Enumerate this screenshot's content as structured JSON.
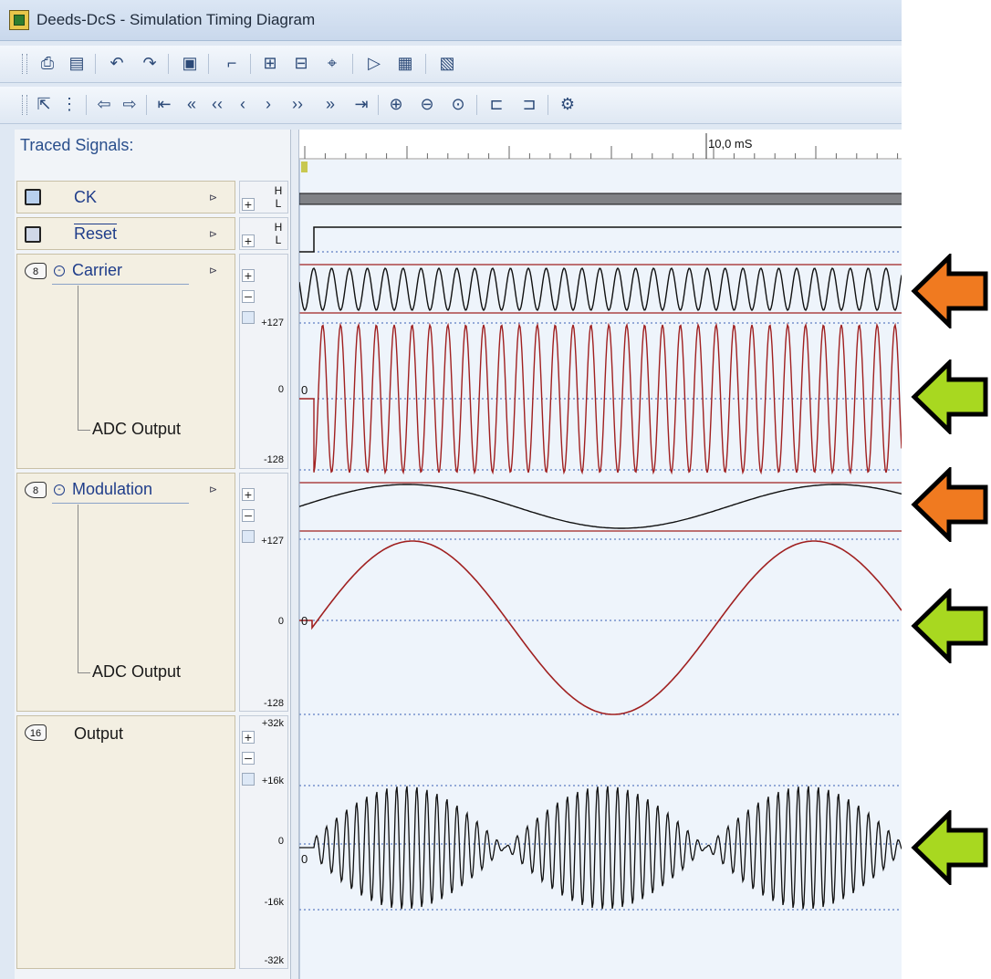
{
  "window": {
    "title": "Deeds-DcS  -  Simulation Timing Diagram"
  },
  "toolbar1": {
    "icons": [
      "print-icon",
      "page-setup-icon",
      "undo-icon",
      "redo-icon",
      "clipboard-icon",
      "edge-icon",
      "grid-icon",
      "signals-icon",
      "cursor-icon",
      "play-icon",
      "stop-icon",
      "view-icon"
    ]
  },
  "toolbar2": {
    "icons": [
      "select-icon",
      "step-icon",
      "left-icon",
      "right-icon",
      "begin-icon",
      "fast-back-icon",
      "back-icon",
      "prev-icon",
      "next-icon",
      "forward-icon",
      "fast-forward-icon",
      "end-icon",
      "zoom-in-icon",
      "zoom-out-icon",
      "zoom-fit-icon",
      "marker-left-icon",
      "marker-right-icon",
      "settings-icon"
    ]
  },
  "left_panel": {
    "heading": "Traced Signals:"
  },
  "timeline": {
    "label": "10,0 mS"
  },
  "signals": [
    {
      "name": "CK",
      "high": "H",
      "low": "L"
    },
    {
      "name": "Reset",
      "high": "H",
      "low": "L"
    },
    {
      "name": "Carrier",
      "sub": "ADC Output",
      "max": "+127",
      "zero": "0",
      "min": "-128",
      "bits": "8"
    },
    {
      "name": "Modulation",
      "sub": "ADC Output",
      "max": "+127",
      "zero": "0",
      "min": "-128",
      "bits": "8"
    },
    {
      "name": "Output",
      "max": "+32k",
      "half": "+16k",
      "zero": "0",
      "nhalf": "-16k",
      "min": "-32k",
      "bits": "16"
    }
  ],
  "wave_labels": {
    "carrier_zero": "0",
    "modulation_zero": "0",
    "output_zero": "0"
  },
  "colors": {
    "analog_wave": "#a02020",
    "digital_wave": "#111111",
    "orange_arrow": "#f07a20",
    "green_arrow": "#a8d820",
    "label_blue": "#1f3d8a"
  }
}
